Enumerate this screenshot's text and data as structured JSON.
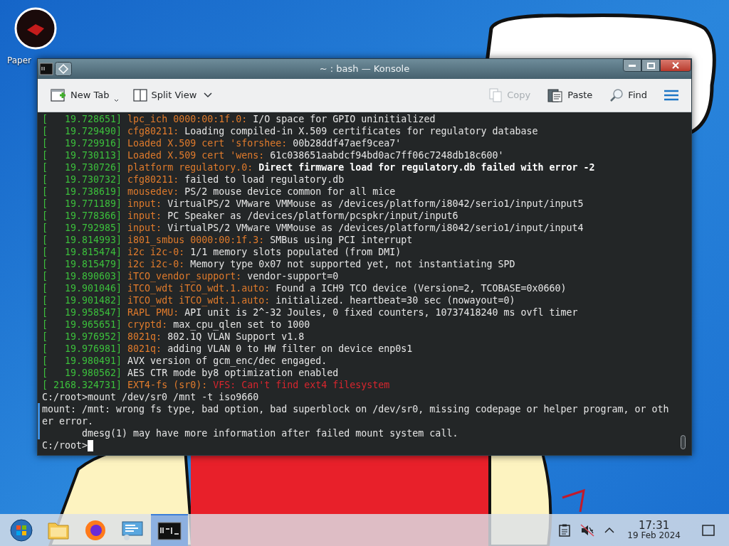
{
  "desktop": {
    "icons": [
      {
        "label": "Paper"
      }
    ]
  },
  "window": {
    "title": "~ : bash — Konsole",
    "toolbar": {
      "left": [
        {
          "kind": "new-tab",
          "label": "New Tab",
          "disabled": false
        },
        {
          "kind": "split-view",
          "label": "Split View",
          "disabled": false
        }
      ],
      "right": [
        {
          "kind": "copy",
          "label": "Copy",
          "disabled": true
        },
        {
          "kind": "paste",
          "label": "Paste",
          "disabled": false
        },
        {
          "kind": "find",
          "label": "Find",
          "disabled": false
        },
        {
          "kind": "menu"
        }
      ]
    },
    "terminal": {
      "log": [
        {
          "time": "[   19.728651]",
          "tag": "lpc_ich 0000:00:1f.0:",
          "msg": " I/O space for GPIO uninitialized",
          "kind": "plain"
        },
        {
          "time": "[   19.729490]",
          "tag": "cfg80211:",
          "msg": " Loading compiled-in X.509 certificates for regulatory database",
          "kind": "plain"
        },
        {
          "time": "[   19.729916]",
          "tag": "Loaded X.509 cert 'sforshee:",
          "msg": " 00b28ddf47aef9cea7'",
          "kind": "plain"
        },
        {
          "time": "[   19.730113]",
          "tag": "Loaded X.509 cert 'wens:",
          "msg": " 61c038651aabdcf94bd0ac7ff06c7248db18c600'",
          "kind": "plain"
        },
        {
          "time": "[   19.730726]",
          "tag": "platform regulatory.0:",
          "msg": " Direct firmware load for regulatory.db failed with error -2",
          "kind": "bold"
        },
        {
          "time": "[   19.730732]",
          "tag": "cfg80211:",
          "msg": " failed to load regulatory.db",
          "kind": "plain"
        },
        {
          "time": "[   19.738619]",
          "tag": "mousedev:",
          "msg": " PS/2 mouse device common for all mice",
          "kind": "plain"
        },
        {
          "time": "[   19.771189]",
          "tag": "input:",
          "msg": " VirtualPS/2 VMware VMMouse as /devices/platform/i8042/serio1/input/input5",
          "kind": "plain"
        },
        {
          "time": "[   19.778366]",
          "tag": "input:",
          "msg": " PC Speaker as /devices/platform/pcspkr/input/input6",
          "kind": "plain"
        },
        {
          "time": "[   19.792985]",
          "tag": "input:",
          "msg": " VirtualPS/2 VMware VMMouse as /devices/platform/i8042/serio1/input/input4",
          "kind": "plain"
        },
        {
          "time": "[   19.814993]",
          "tag": "i801_smbus 0000:00:1f.3:",
          "msg": " SMBus using PCI interrupt",
          "kind": "plain"
        },
        {
          "time": "[   19.815474]",
          "tag": "i2c i2c-0:",
          "msg": " 1/1 memory slots populated (from DMI)",
          "kind": "plain"
        },
        {
          "time": "[   19.815479]",
          "tag": "i2c i2c-0:",
          "msg": " Memory type 0x07 not supported yet, not instantiating SPD",
          "kind": "plain"
        },
        {
          "time": "[   19.890603]",
          "tag": "iTCO_vendor_support:",
          "msg": " vendor-support=0",
          "kind": "plain"
        },
        {
          "time": "[   19.901046]",
          "tag": "iTCO_wdt iTCO_wdt.1.auto:",
          "msg": " Found a ICH9 TCO device (Version=2, TCOBASE=0x0660)",
          "kind": "plain"
        },
        {
          "time": "[   19.901482]",
          "tag": "iTCO_wdt iTCO_wdt.1.auto:",
          "msg": " initialized. heartbeat=30 sec (nowayout=0)",
          "kind": "plain"
        },
        {
          "time": "[   19.958547]",
          "tag": "RAPL PMU:",
          "msg": " API unit is 2^-32 Joules, 0 fixed counters, 10737418240 ms ovfl timer",
          "kind": "plain"
        },
        {
          "time": "[   19.965651]",
          "tag": "cryptd:",
          "msg": " max_cpu_qlen set to 1000",
          "kind": "plain"
        },
        {
          "time": "[   19.976952]",
          "tag": "8021q:",
          "msg": " 802.1Q VLAN Support v1.8",
          "kind": "plain"
        },
        {
          "time": "[   19.976981]",
          "tag": "8021q:",
          "msg": " adding VLAN 0 to HW filter on device enp0s1",
          "kind": "plain"
        },
        {
          "time": "[   19.980491]",
          "msg": "AVX version of gcm_enc/dec engaged.",
          "kind": "plain"
        },
        {
          "time": "[   19.980562]",
          "msg": "AES CTR mode by8 optimization enabled",
          "kind": "plain"
        },
        {
          "time": "[ 2168.324731]",
          "tag": "EXT4-fs (sr0):",
          "msg": " VFS: Can't find ext4 filesystem",
          "kind": "error"
        }
      ],
      "output": [
        {
          "kind": "command",
          "text": "C:/root>mount /dev/sr0 /mnt -t iso9660"
        },
        {
          "kind": "output",
          "text": "mount: /mnt: wrong fs type, bad option, bad superblock on /dev/sr0, missing codepage or helper program, or oth"
        },
        {
          "kind": "output",
          "text": "er error."
        },
        {
          "kind": "output",
          "text": "       dmesg(1) may have more information after failed mount system call."
        },
        {
          "kind": "prompt",
          "text": "C:/root>"
        }
      ]
    }
  },
  "taskbar": {
    "apps": [
      {
        "kind": "start",
        "active": false
      },
      {
        "kind": "files",
        "active": false
      },
      {
        "kind": "browser",
        "active": false
      },
      {
        "kind": "settings",
        "active": false
      },
      {
        "kind": "terminal",
        "active": true
      }
    ],
    "tray": [
      {
        "kind": "clipboard"
      },
      {
        "kind": "muted"
      },
      {
        "kind": "expand"
      }
    ],
    "clock": {
      "time": "17:31",
      "date": "19 Feb 2024"
    }
  }
}
